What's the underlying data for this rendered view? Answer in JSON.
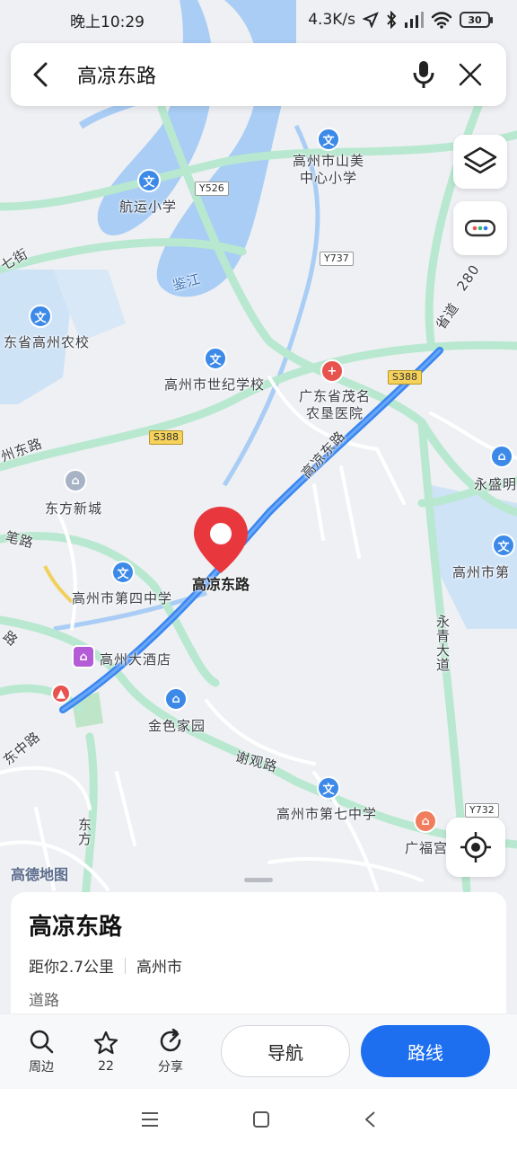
{
  "status_bar": {
    "time": "晚上10:29",
    "network_speed": "4.3K/s",
    "battery": "30"
  },
  "search": {
    "query": "高凉东路"
  },
  "map": {
    "watermark": "高德地图",
    "pin_label": "高凉东路",
    "labels": {
      "hangyun": "航运小学",
      "shanmei": "高州市山美\n中心小学",
      "nongxiao": "东省高州农校",
      "shiji": "高州市世纪学校",
      "nongken": "广东省茂名\n农垦医院",
      "dongfang": "东方新城",
      "sizhong": "高州市第四中学",
      "jiudian": "高州大酒店",
      "jinse": "金色家园",
      "qizhong": "高州市第七中学",
      "yongsheng": "永盛明",
      "gaozhoushi": "高州市第",
      "guangfu": "广福宫",
      "jianjiang": "鉴江",
      "xieguan": "谢观路",
      "yongqing": "永青大道",
      "shenglu": "省道",
      "zhoudong": "州东路",
      "bilu": "笔路",
      "lu": "路",
      "jiezhong": "东中路",
      "dongfang_road": "东方",
      "qijie": "七街",
      "road_gaoliang": "高凉东路",
      "road_num": "280"
    },
    "badges": {
      "y526": "Y526",
      "y737": "Y737",
      "s388a": "S388",
      "s388b": "S388",
      "y732": "Y732"
    }
  },
  "place": {
    "name": "高凉东路",
    "distance": "距你2.7公里",
    "city": "高州市",
    "type": "道路"
  },
  "actions": {
    "nearby": "周边",
    "favorite_count": "22",
    "share": "分享",
    "navigate": "导航",
    "route": "路线"
  },
  "colors": {
    "route": "#3b86f0",
    "road": "#b8e8cf",
    "river": "#a9cdf5",
    "accent": "#1e6ff0",
    "pin": "#e8383d"
  }
}
